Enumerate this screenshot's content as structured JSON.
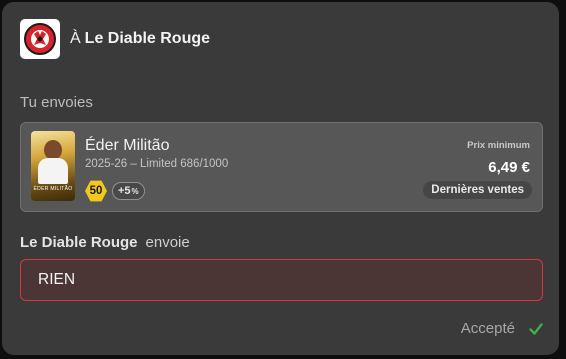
{
  "header": {
    "prefix": "À",
    "club_name": "Le Diable Rouge",
    "logo_icon": "club-crest-icon"
  },
  "you_send": {
    "label": "Tu envoies",
    "player": {
      "name": "Éder Militão",
      "subtitle": "2025-26 – Limited 686/1000",
      "card_mini_name": "ÉDER MILITÃO",
      "rating": "50",
      "boost": "+5",
      "boost_unit": "%"
    },
    "min_price_label": "Prix minimum",
    "min_price_value": "6,49 €",
    "recent_sales_label": "Dernières ventes"
  },
  "they_send": {
    "sender_name": "Le Diable Rouge",
    "verb": "envoie",
    "content": "RIEN"
  },
  "status": {
    "label": "Accepté",
    "icon": "check-icon"
  },
  "colors": {
    "accent_red": "#d6383e",
    "rating_yellow": "#f2c81d",
    "check_green": "#3cb043"
  }
}
